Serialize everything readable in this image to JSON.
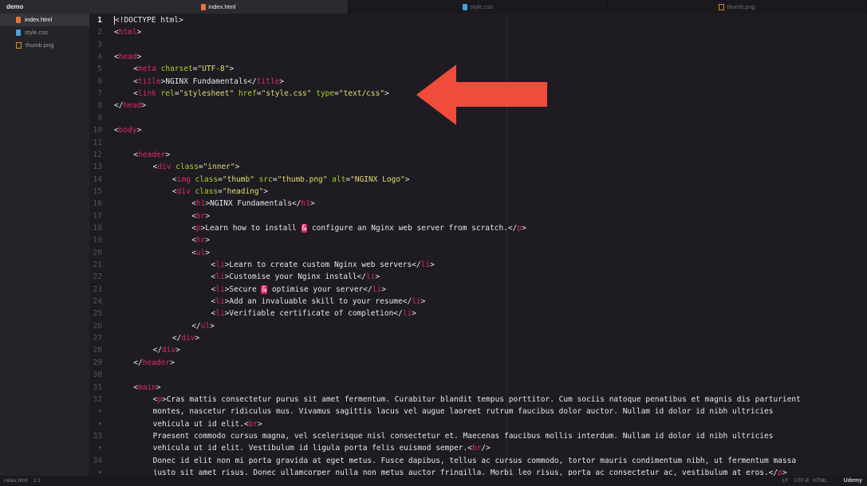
{
  "sidebar": {
    "project": "demo",
    "files": [
      {
        "name": "index.html",
        "type": "html",
        "active": true
      },
      {
        "name": "style.css",
        "type": "css",
        "active": false
      },
      {
        "name": "thumb.png",
        "type": "png",
        "active": false
      }
    ]
  },
  "tabs": [
    {
      "label": "index.html",
      "type": "html",
      "active": true
    },
    {
      "label": "style.css",
      "type": "css",
      "active": false
    },
    {
      "label": "thumb.png",
      "type": "png",
      "active": false
    }
  ],
  "editor": {
    "current_line": 1,
    "lines": [
      {
        "n": "1",
        "indent": 0,
        "parts": [
          [
            "p",
            "<!DOCTYPE html>"
          ]
        ]
      },
      {
        "n": "2",
        "indent": 0,
        "parts": [
          [
            "p",
            "<"
          ],
          [
            "t",
            "html"
          ],
          [
            "p",
            ">"
          ]
        ]
      },
      {
        "n": "3",
        "indent": 0,
        "parts": []
      },
      {
        "n": "4",
        "indent": 0,
        "parts": [
          [
            "p",
            "<"
          ],
          [
            "t",
            "head"
          ],
          [
            "p",
            ">"
          ]
        ]
      },
      {
        "n": "5",
        "indent": 1,
        "parts": [
          [
            "p",
            "<"
          ],
          [
            "t",
            "meta"
          ],
          [
            "p",
            " "
          ],
          [
            "a",
            "charset"
          ],
          [
            "p",
            "="
          ],
          [
            "s",
            "\"UTF-8\""
          ],
          [
            "p",
            ">"
          ]
        ]
      },
      {
        "n": "6",
        "indent": 1,
        "parts": [
          [
            "p",
            "<"
          ],
          [
            "t",
            "title"
          ],
          [
            "p",
            ">NGINX Fundamentals</"
          ],
          [
            "t",
            "title"
          ],
          [
            "p",
            ">"
          ]
        ]
      },
      {
        "n": "7",
        "indent": 1,
        "parts": [
          [
            "p",
            "<"
          ],
          [
            "t",
            "link"
          ],
          [
            "p",
            " "
          ],
          [
            "a",
            "rel"
          ],
          [
            "p",
            "="
          ],
          [
            "s",
            "\"stylesheet\""
          ],
          [
            "p",
            " "
          ],
          [
            "a",
            "href"
          ],
          [
            "p",
            "="
          ],
          [
            "s",
            "\"style.css\""
          ],
          [
            "p",
            " "
          ],
          [
            "a",
            "type"
          ],
          [
            "p",
            "="
          ],
          [
            "s",
            "\"text/css\""
          ],
          [
            "p",
            ">"
          ]
        ]
      },
      {
        "n": "8",
        "indent": 0,
        "parts": [
          [
            "p",
            "</"
          ],
          [
            "t",
            "head"
          ],
          [
            "p",
            ">"
          ]
        ]
      },
      {
        "n": "9",
        "indent": 0,
        "parts": []
      },
      {
        "n": "10",
        "indent": 0,
        "parts": [
          [
            "p",
            "<"
          ],
          [
            "t",
            "body"
          ],
          [
            "p",
            ">"
          ]
        ]
      },
      {
        "n": "11",
        "indent": 0,
        "parts": []
      },
      {
        "n": "12",
        "indent": 1,
        "parts": [
          [
            "p",
            "<"
          ],
          [
            "t",
            "header"
          ],
          [
            "p",
            ">"
          ]
        ]
      },
      {
        "n": "13",
        "indent": 2,
        "parts": [
          [
            "p",
            "<"
          ],
          [
            "t",
            "div"
          ],
          [
            "p",
            " "
          ],
          [
            "a",
            "class"
          ],
          [
            "p",
            "="
          ],
          [
            "s",
            "\"inner\""
          ],
          [
            "p",
            ">"
          ]
        ]
      },
      {
        "n": "14",
        "indent": 3,
        "parts": [
          [
            "p",
            "<"
          ],
          [
            "t",
            "img"
          ],
          [
            "p",
            " "
          ],
          [
            "a",
            "class"
          ],
          [
            "p",
            "="
          ],
          [
            "s",
            "\"thumb\""
          ],
          [
            "p",
            " "
          ],
          [
            "a",
            "src"
          ],
          [
            "p",
            "="
          ],
          [
            "s",
            "\"thumb.png\""
          ],
          [
            "p",
            " "
          ],
          [
            "a",
            "alt"
          ],
          [
            "p",
            "="
          ],
          [
            "s",
            "\"NGINX Logo\""
          ],
          [
            "p",
            ">"
          ]
        ]
      },
      {
        "n": "15",
        "indent": 3,
        "parts": [
          [
            "p",
            "<"
          ],
          [
            "t",
            "div"
          ],
          [
            "p",
            " "
          ],
          [
            "a",
            "class"
          ],
          [
            "p",
            "="
          ],
          [
            "s",
            "\"heading\""
          ],
          [
            "p",
            ">"
          ]
        ]
      },
      {
        "n": "16",
        "indent": 4,
        "parts": [
          [
            "p",
            "<"
          ],
          [
            "t",
            "h1"
          ],
          [
            "p",
            ">NGINX Fundamentals</"
          ],
          [
            "t",
            "h1"
          ],
          [
            "p",
            ">"
          ]
        ]
      },
      {
        "n": "17",
        "indent": 4,
        "parts": [
          [
            "p",
            "<"
          ],
          [
            "t",
            "br"
          ],
          [
            "p",
            ">"
          ]
        ]
      },
      {
        "n": "18",
        "indent": 4,
        "parts": [
          [
            "p",
            "<"
          ],
          [
            "t",
            "p"
          ],
          [
            "p",
            ">Learn how to install "
          ],
          [
            "amp",
            "&"
          ],
          [
            "p",
            " configure an Nginx web server from scratch.</"
          ],
          [
            "t",
            "p"
          ],
          [
            "p",
            ">"
          ]
        ]
      },
      {
        "n": "19",
        "indent": 4,
        "parts": [
          [
            "p",
            "<"
          ],
          [
            "t",
            "hr"
          ],
          [
            "p",
            ">"
          ]
        ]
      },
      {
        "n": "20",
        "indent": 4,
        "parts": [
          [
            "p",
            "<"
          ],
          [
            "t",
            "ul"
          ],
          [
            "p",
            ">"
          ]
        ]
      },
      {
        "n": "21",
        "indent": 5,
        "parts": [
          [
            "p",
            "<"
          ],
          [
            "t",
            "li"
          ],
          [
            "p",
            ">Learn to create custom Nginx web servers</"
          ],
          [
            "t",
            "li"
          ],
          [
            "p",
            ">"
          ]
        ]
      },
      {
        "n": "22",
        "indent": 5,
        "parts": [
          [
            "p",
            "<"
          ],
          [
            "t",
            "li"
          ],
          [
            "p",
            ">Customise your Nginx install</"
          ],
          [
            "t",
            "li"
          ],
          [
            "p",
            ">"
          ]
        ]
      },
      {
        "n": "23",
        "indent": 5,
        "parts": [
          [
            "p",
            "<"
          ],
          [
            "t",
            "li"
          ],
          [
            "p",
            ">Secure "
          ],
          [
            "amp",
            "&"
          ],
          [
            "p",
            " optimise your server</"
          ],
          [
            "t",
            "li"
          ],
          [
            "p",
            ">"
          ]
        ]
      },
      {
        "n": "24",
        "indent": 5,
        "parts": [
          [
            "p",
            "<"
          ],
          [
            "t",
            "li"
          ],
          [
            "p",
            ">Add an invaluable skill to your resume</"
          ],
          [
            "t",
            "li"
          ],
          [
            "p",
            ">"
          ]
        ]
      },
      {
        "n": "25",
        "indent": 5,
        "parts": [
          [
            "p",
            "<"
          ],
          [
            "t",
            "li"
          ],
          [
            "p",
            ">Verifiable certificate of completion</"
          ],
          [
            "t",
            "li"
          ],
          [
            "p",
            ">"
          ]
        ]
      },
      {
        "n": "26",
        "indent": 4,
        "parts": [
          [
            "p",
            "</"
          ],
          [
            "t",
            "ul"
          ],
          [
            "p",
            ">"
          ]
        ]
      },
      {
        "n": "27",
        "indent": 3,
        "parts": [
          [
            "p",
            "</"
          ],
          [
            "t",
            "div"
          ],
          [
            "p",
            ">"
          ]
        ]
      },
      {
        "n": "28",
        "indent": 2,
        "parts": [
          [
            "p",
            "</"
          ],
          [
            "t",
            "div"
          ],
          [
            "p",
            ">"
          ]
        ]
      },
      {
        "n": "29",
        "indent": 1,
        "parts": [
          [
            "p",
            "</"
          ],
          [
            "t",
            "header"
          ],
          [
            "p",
            ">"
          ]
        ]
      },
      {
        "n": "30",
        "indent": 0,
        "parts": []
      },
      {
        "n": "31",
        "indent": 1,
        "parts": [
          [
            "p",
            "<"
          ],
          [
            "t",
            "main"
          ],
          [
            "p",
            ">"
          ]
        ]
      },
      {
        "n": "32",
        "indent": 2,
        "parts": [
          [
            "p",
            "<"
          ],
          [
            "t",
            "p"
          ],
          [
            "p",
            ">Cras mattis consectetur purus sit amet fermentum. Curabitur blandit tempus porttitor. Cum sociis natoque penatibus et magnis dis parturient"
          ]
        ]
      },
      {
        "n": "•",
        "indent": 2,
        "parts": [
          [
            "p",
            "montes, nascetur ridiculus mus. Vivamus sagittis lacus vel augue laoreet rutrum faucibus dolor auctor. Nullam id dolor id nibh ultricies"
          ]
        ]
      },
      {
        "n": "•",
        "indent": 2,
        "parts": [
          [
            "p",
            "vehicula ut id elit.<"
          ],
          [
            "t",
            "br"
          ],
          [
            "p",
            ">"
          ]
        ]
      },
      {
        "n": "33",
        "indent": 2,
        "parts": [
          [
            "p",
            "Praesent commodo cursus magna, vel scelerisque nisl consectetur et. Maecenas faucibus mollis interdum. Nullam id dolor id nibh ultricies"
          ]
        ]
      },
      {
        "n": "•",
        "indent": 2,
        "parts": [
          [
            "p",
            "vehicula ut id elit. Vestibulum id ligula porta felis euismod semper.<"
          ],
          [
            "t",
            "br"
          ],
          [
            "p",
            "/>"
          ]
        ]
      },
      {
        "n": "34",
        "indent": 2,
        "parts": [
          [
            "p",
            "Donec id elit non mi porta gravida at eget metus. Fusce dapibus, tellus ac cursus commodo, tortor mauris condimentum nibh, ut fermentum massa"
          ]
        ]
      },
      {
        "n": "•",
        "indent": 2,
        "parts": [
          [
            "p",
            "justo sit amet risus. Donec ullamcorper nulla non metus auctor fringilla. Morbi leo risus, porta ac consectetur ac, vestibulum at eros.</"
          ],
          [
            "t",
            "p"
          ],
          [
            "p",
            ">"
          ]
        ]
      }
    ]
  },
  "statusbar": {
    "file": "index.html",
    "position": "1:1",
    "line_ending": "LF",
    "encoding": "UTF-8",
    "language": "HTML",
    "watermark": "Udemy"
  },
  "annotation": {
    "shape": "arrow-left",
    "color": "#f14b3c"
  }
}
